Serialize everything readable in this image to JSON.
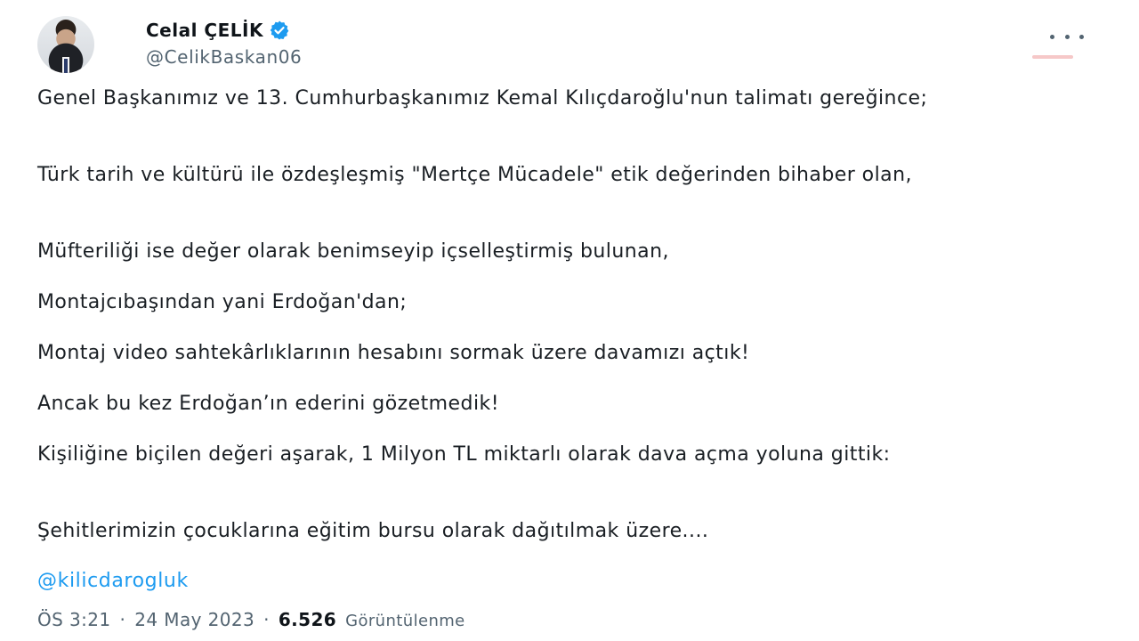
{
  "author": {
    "display_name": "Celal ÇELİK",
    "handle": "@CelikBaskan06",
    "verified": true,
    "verified_color": "#1d9bf0"
  },
  "tweet": {
    "paragraphs": [
      "Genel Başkanımız ve 13. Cumhurbaşkanımız Kemal Kılıçdaroğlu'nun talimatı gereğince;",
      "Türk tarih ve kültürü ile özdeşleşmiş \"Mertçe Mücadele\" etik değerinden bihaber olan,",
      "Müfteriliği ise değer olarak benimseyip içselleştirmiş bulunan,",
      "Montajcıbaşından yani Erdoğan'dan;",
      "Montaj video sahtekârlıklarının hesabını sormak üzere davamızı açtık!",
      "Ancak bu kez Erdoğan’ın ederini gözetmedik!",
      "Kişiliğine biçilen değeri aşarak, 1 Milyon TL miktarlı olarak dava açma yoluna gittik:",
      "Şehitlerimizin çocuklarına eğitim bursu olarak dağıtılmak üzere...."
    ],
    "mention": "@kilicdarogluk",
    "mention_color": "#1d9bf0"
  },
  "meta": {
    "time": "ÖS 3:21",
    "separator": "·",
    "date": "24 May 2023",
    "views_count": "6.526",
    "views_label": "Görüntülenme"
  },
  "icons": {
    "more": "more-horizontal-icon",
    "verified": "verified-badge-icon"
  }
}
